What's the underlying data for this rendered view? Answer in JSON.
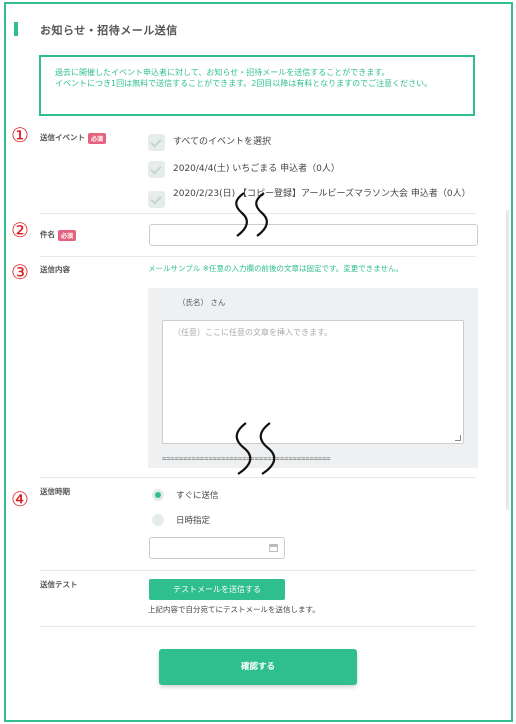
{
  "page": {
    "title": "お知らせ・招待メール送信",
    "notice_line1": "過去に開催したイベント申込者に対して、お知らせ・招待メールを送信することができます。",
    "notice_line2": "イベントにつき1回は無料で送信することができます。2回目以降は有料となりますのでご注意ください。"
  },
  "markers": [
    "①",
    "②",
    "③",
    "④"
  ],
  "fields": {
    "events": {
      "label": "送信イベント",
      "required": "必須",
      "options": [
        {
          "label": "すべてのイベントを選択",
          "checked": true
        },
        {
          "label": "2020/4/4(土) いちごまる 申込者（0人）",
          "checked": true
        },
        {
          "label": "2020/2/23(日) 【コピー登録】アールビーズマラソン大会 申込者（0人）",
          "checked": true
        }
      ]
    },
    "subject": {
      "label": "件名",
      "required": "必須",
      "value": ""
    },
    "body": {
      "label": "送信内容",
      "sample_note": "メールサンプル ※任意の入力欄の前後の文章は固定です。変更できません。",
      "greeting": "（氏名） さん",
      "placeholder": "（任意）ここに任意の文章を挿入できます。",
      "separator": "========================================"
    },
    "timing": {
      "label": "送信時期",
      "options": [
        {
          "label": "すぐに送信",
          "selected": true
        },
        {
          "label": "日時指定",
          "selected": false
        }
      ],
      "date_value": ""
    },
    "test": {
      "label": "送信テスト",
      "button": "テストメールを送信する",
      "note": "上記内容で自分宛てにテストメールを送信します。"
    }
  },
  "confirm_button": "確認する",
  "colors": {
    "accent": "#2fbf8e",
    "required": "#e5617d",
    "marker": "#e0191e"
  }
}
